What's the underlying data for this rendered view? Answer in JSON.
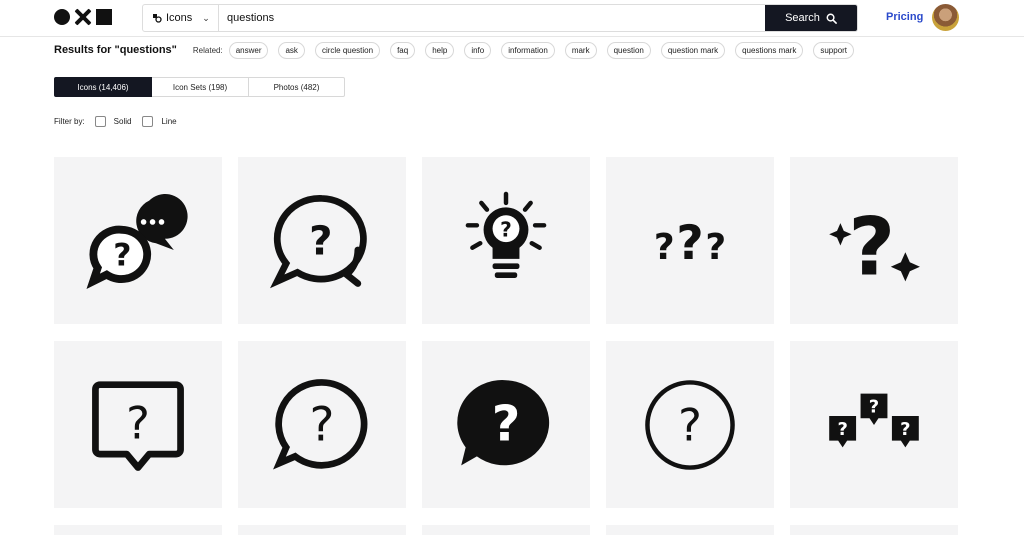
{
  "header": {
    "logo": "logo",
    "search_type": "Icons",
    "search_value": "questions",
    "search_button": "Search",
    "pricing": "Pricing"
  },
  "results": {
    "title": "Results for \"questions\"",
    "related_label": "Related:",
    "related": [
      "answer",
      "ask",
      "circle question",
      "faq",
      "help",
      "info",
      "information",
      "mark",
      "question",
      "question mark",
      "questions mark",
      "support"
    ]
  },
  "tabs": [
    {
      "label": "Icons (14,406)",
      "active": true
    },
    {
      "label": "Icon Sets (198)",
      "active": false
    },
    {
      "label": "Photos (482)",
      "active": false
    }
  ],
  "filters": {
    "label": "Filter by:",
    "options": [
      "Solid",
      "Line"
    ]
  },
  "icons": [
    "chat-bubbles-question-icon",
    "chat-bubble-question-outline-icon",
    "lightbulb-question-icon",
    "three-question-marks-icon",
    "question-mark-sparkle-icon",
    "square-speech-question-icon",
    "round-speech-question-icon",
    "filled-speech-question-icon",
    "circle-question-icon",
    "three-speech-question-icon"
  ],
  "colors": {
    "accent": "#2b4acb",
    "dark": "#141722",
    "tile_bg": "#f4f4f5"
  }
}
